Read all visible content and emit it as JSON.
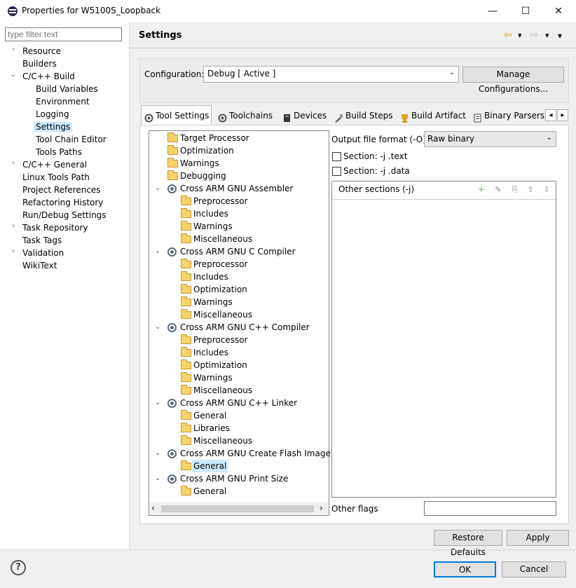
{
  "window": {
    "title": "Properties for W5100S_Loopback",
    "minimize": "—",
    "maximize": "☐",
    "close": "✕"
  },
  "filter": {
    "placeholder": "type filter text"
  },
  "nav": [
    {
      "label": "Resource",
      "expander": "›"
    },
    {
      "label": "Builders"
    },
    {
      "label": "C/C++ Build",
      "expander": "⌄"
    },
    {
      "label": "Build Variables"
    },
    {
      "label": "Environment"
    },
    {
      "label": "Logging"
    },
    {
      "label": "Settings"
    },
    {
      "label": "Tool Chain Editor"
    },
    {
      "label": "Tools Paths"
    },
    {
      "label": "C/C++ General",
      "expander": "›"
    },
    {
      "label": "Linux Tools Path"
    },
    {
      "label": "Project References"
    },
    {
      "label": "Refactoring History"
    },
    {
      "label": "Run/Debug Settings"
    },
    {
      "label": "Task Repository",
      "expander": "›"
    },
    {
      "label": "Task Tags"
    },
    {
      "label": "Validation",
      "expander": "›"
    },
    {
      "label": "WikiText"
    }
  ],
  "header": {
    "title": "Settings",
    "back": "⇦",
    "forward": "⇨",
    "dropdown": "▾",
    "menu": "▾"
  },
  "config": {
    "label": "Configuration:",
    "value": "Debug  [ Active ]",
    "arrow": "⌄",
    "manage_button": "Manage Configurations..."
  },
  "tabs": [
    {
      "label": "Tool Settings",
      "icon": "tool-settings-icon"
    },
    {
      "label": "Toolchains",
      "icon": "toolchains-icon"
    },
    {
      "label": "Devices",
      "icon": "devices-icon"
    },
    {
      "label": "Build Steps",
      "icon": "build-steps-icon"
    },
    {
      "label": "Build Artifact",
      "icon": "build-artifact-icon"
    },
    {
      "label": "Binary Parsers",
      "icon": "binary-parsers-icon"
    }
  ],
  "tab_scroll": {
    "left": "◂",
    "right": "▸"
  },
  "tree": [
    {
      "label": "Target Processor",
      "icon": "folder"
    },
    {
      "label": "Optimization",
      "icon": "folder"
    },
    {
      "label": "Warnings",
      "icon": "folder"
    },
    {
      "label": "Debugging",
      "icon": "folder"
    },
    {
      "label": "Cross ARM GNU Assembler",
      "icon": "gear",
      "expander": "⌄"
    },
    {
      "label": "Preprocessor",
      "icon": "folder"
    },
    {
      "label": "Includes",
      "icon": "folder"
    },
    {
      "label": "Warnings",
      "icon": "folder"
    },
    {
      "label": "Miscellaneous",
      "icon": "folder"
    },
    {
      "label": "Cross ARM GNU C Compiler",
      "icon": "gear",
      "expander": "⌄"
    },
    {
      "label": "Preprocessor",
      "icon": "folder"
    },
    {
      "label": "Includes",
      "icon": "folder"
    },
    {
      "label": "Optimization",
      "icon": "folder"
    },
    {
      "label": "Warnings",
      "icon": "folder"
    },
    {
      "label": "Miscellaneous",
      "icon": "folder"
    },
    {
      "label": "Cross ARM GNU C++ Compiler",
      "icon": "gear",
      "expander": "⌄"
    },
    {
      "label": "Preprocessor",
      "icon": "folder"
    },
    {
      "label": "Includes",
      "icon": "folder"
    },
    {
      "label": "Optimization",
      "icon": "folder"
    },
    {
      "label": "Warnings",
      "icon": "folder"
    },
    {
      "label": "Miscellaneous",
      "icon": "folder"
    },
    {
      "label": "Cross ARM GNU C++ Linker",
      "icon": "gear",
      "expander": "⌄"
    },
    {
      "label": "General",
      "icon": "folder"
    },
    {
      "label": "Libraries",
      "icon": "folder"
    },
    {
      "label": "Miscellaneous",
      "icon": "folder"
    },
    {
      "label": "Cross ARM GNU Create Flash Image",
      "icon": "gear",
      "expander": "⌄"
    },
    {
      "label": "General",
      "icon": "folder"
    },
    {
      "label": "Cross ARM GNU Print Size",
      "icon": "gear",
      "expander": "⌄"
    },
    {
      "label": "General",
      "icon": "folder"
    }
  ],
  "hscroll": {
    "left": "‹",
    "right": "›"
  },
  "details": {
    "output_format_label": "Output file format (-O)",
    "output_format_value": "Raw binary",
    "output_format_arrow": "⌄",
    "section_text_label": "Section: -j .text",
    "section_data_label": "Section: -j .data",
    "other_sections_label": "Other sections (-j)",
    "section_buttons": [
      "＋",
      "✎",
      "⎘",
      "⇧",
      "⇩"
    ],
    "other_flags_label": "Other flags",
    "other_flags_value": ""
  },
  "buttons": {
    "restore_defaults": "Restore Defaults",
    "apply": "Apply",
    "ok": "OK",
    "cancel": "Cancel",
    "help": "?"
  }
}
